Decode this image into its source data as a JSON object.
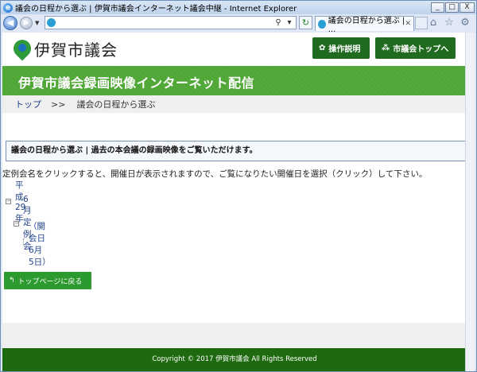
{
  "window": {
    "title": "議会の日程から選ぶ | 伊賀市議会インターネット議会中継 - Internet Explorer",
    "tab_title": "議会の日程から選ぶ | ...",
    "minimize": "_",
    "maximize": "□",
    "close": "X"
  },
  "icons": {
    "back": "back-arrow-icon",
    "forward": "forward-arrow-icon",
    "search": "search-icon",
    "refresh": "refresh-icon",
    "home": "home-icon",
    "favorites": "star-icon",
    "settings": "gear-icon"
  },
  "site": {
    "logo_text": "伊賀市議会",
    "btn_manual": "操作説明",
    "btn_top": "市議会トップへ",
    "banner_title": "伊賀市議会録画映像インターネット配信"
  },
  "breadcrumb": {
    "home": "トップ",
    "sep": ">>",
    "current": "議会の日程から選ぶ"
  },
  "main": {
    "notice": "議会の日程から選ぶ | 過去の本会議の録画映像をご覧いただけます。",
    "intro": "定例会名をクリックすると、開催日が表示されますので、ご覧になりたい開催日を選択（クリック）して下さい。",
    "tree": {
      "year": "平成29年",
      "session": "6月定例会",
      "date": "（開会日 6月 5日）"
    },
    "back_button": "トップページに戻る"
  },
  "footer": {
    "copyright": "Copyright © 2017 伊賀市議会 All Rights Reserved"
  },
  "colors": {
    "brand_green": "#54ab3b",
    "dark_green": "#206b1f",
    "footer_green": "#1f6a10",
    "link_blue": "#1f3f8a"
  }
}
